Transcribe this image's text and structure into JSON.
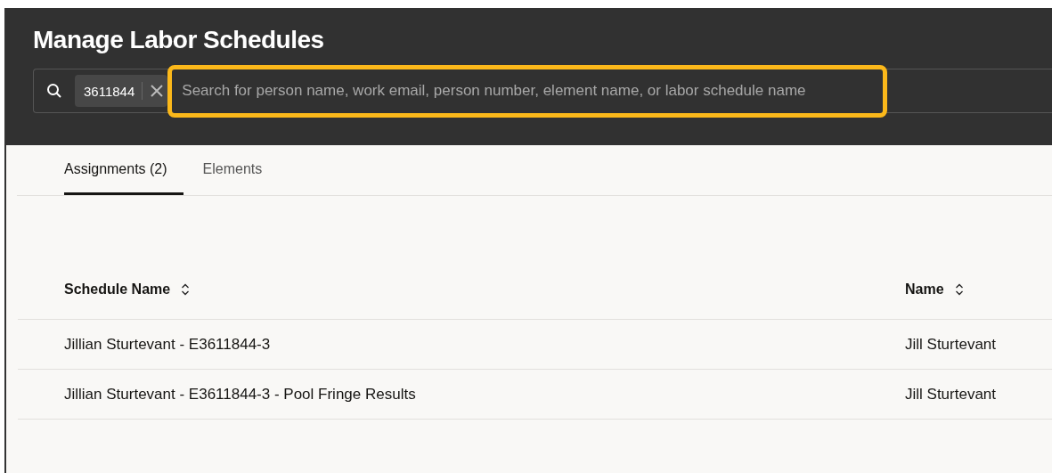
{
  "title": "Manage Labor Schedules",
  "search": {
    "chip": "3611844",
    "placeholder": "Search for person name, work email, person number, element name, or labor schedule name",
    "highlighted": true
  },
  "tabs": [
    {
      "label": "Assignments (2)",
      "selected": true
    },
    {
      "label": "Elements",
      "selected": false
    }
  ],
  "table": {
    "columns": [
      "Schedule Name",
      "Name"
    ],
    "rows": [
      [
        "Jillian Sturtevant - E3611844-3",
        "Jill Sturtevant"
      ],
      [
        "Jillian Sturtevant - E3611844-3 - Pool Fringe Results",
        "Jill Sturtevant"
      ]
    ]
  }
}
